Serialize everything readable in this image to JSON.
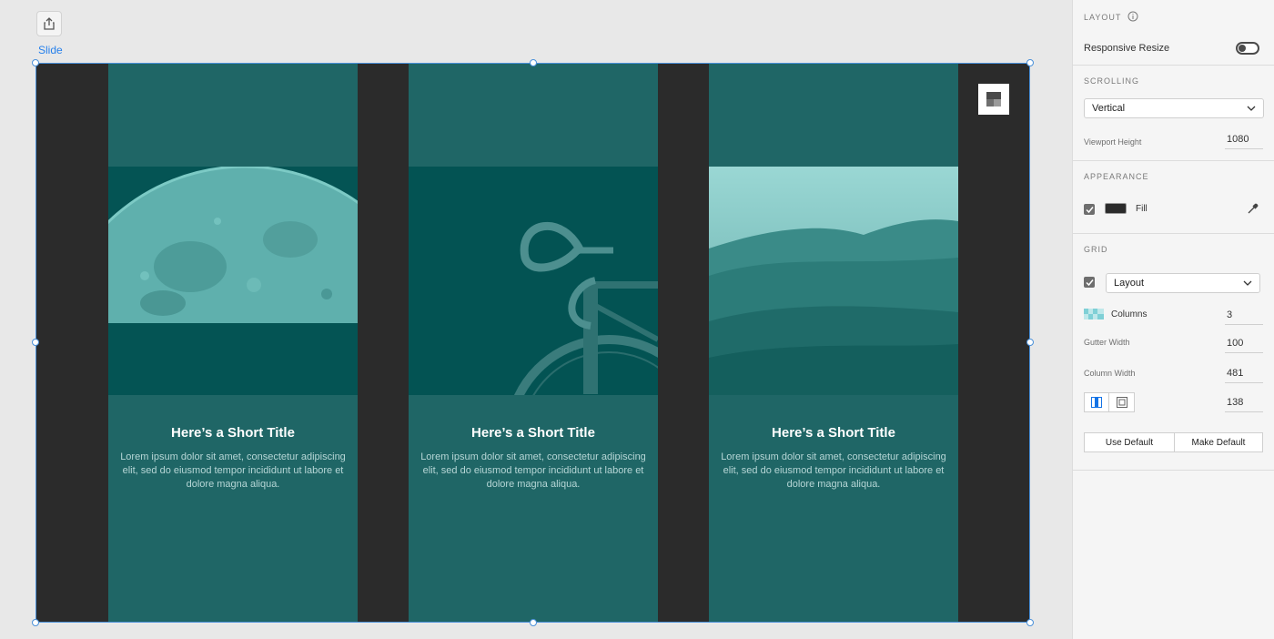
{
  "canvas": {
    "slide_label": "Slide",
    "cards": [
      {
        "title": "Here’s a Short Title",
        "body": "Lorem ipsum dolor sit amet, consectetur adipiscing elit, sed do eiusmod tempor incididunt ut labore et dolore magna aliqua.",
        "image": "moon"
      },
      {
        "title": "Here’s a Short Title",
        "body": "Lorem ipsum dolor sit amet, consectetur adipiscing elit, sed do eiusmod tempor incididunt ut labore et dolore magna aliqua.",
        "image": "bicycle"
      },
      {
        "title": "Here’s a Short Title",
        "body": "Lorem ipsum dolor sit amet, consectetur adipiscing elit, sed do eiusmod tempor incididunt ut labore et dolore magna aliqua.",
        "image": "desert-dunes"
      }
    ]
  },
  "panel": {
    "layout": {
      "title": "LAYOUT",
      "responsive_resize": "Responsive Resize"
    },
    "scrolling": {
      "title": "SCROLLING",
      "mode": "Vertical",
      "viewport_height_label": "Viewport Height",
      "viewport_height": "1080"
    },
    "appearance": {
      "title": "APPEARANCE",
      "fill_label": "Fill",
      "fill_color": "#2b2b2b"
    },
    "grid": {
      "title": "GRID",
      "type": "Layout",
      "columns_label": "Columns",
      "columns": "3",
      "gutter_width_label": "Gutter Width",
      "gutter_width": "100",
      "column_width_label": "Column Width",
      "column_width": "481",
      "margin": "138",
      "use_default": "Use Default",
      "make_default": "Make Default"
    }
  },
  "colors": {
    "accent": "#2680eb",
    "column_teal": "#1f6666",
    "artboard_fill": "#2b2b2b"
  }
}
